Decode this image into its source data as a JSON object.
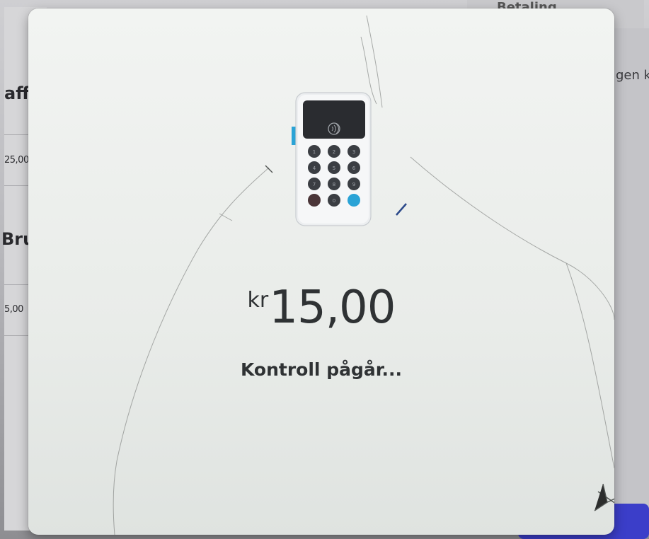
{
  "background": {
    "header_fragment": "Betaling",
    "right_fragment": "gen k",
    "items": [
      {
        "name_fragment": "affe",
        "price_fragment": "25,00"
      },
      {
        "name_fragment": "Brus",
        "price_fragment": "5,00"
      }
    ]
  },
  "payment": {
    "reader_icon": "card-reader-icon",
    "currency": "kr",
    "amount": "15,00",
    "status": "Kontroll pågår..."
  },
  "colors": {
    "modal_bg": "#eef0ee",
    "text": "#2f3234",
    "accent": "#2aa3d6",
    "primary_button": "#3b3ec9"
  }
}
